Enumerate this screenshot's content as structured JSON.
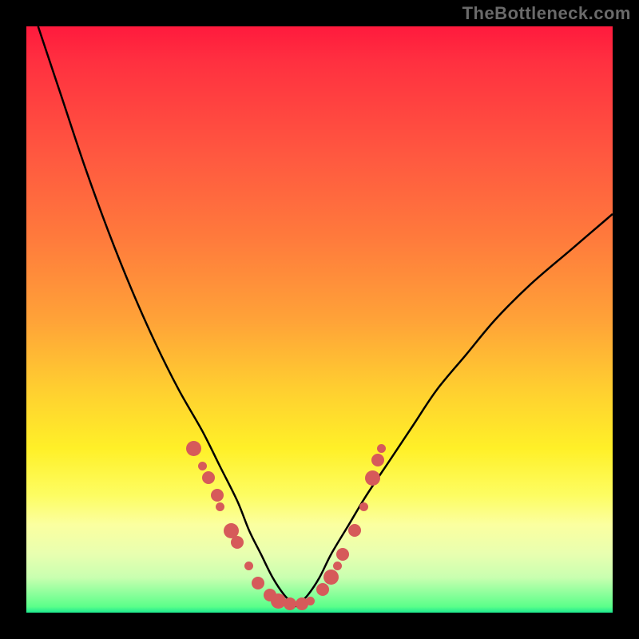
{
  "watermark": "TheBottleneck.com",
  "chart_data": {
    "type": "line",
    "title": "",
    "xlabel": "",
    "ylabel": "",
    "xlim": [
      0,
      100
    ],
    "ylim": [
      0,
      100
    ],
    "gradient_stops": [
      {
        "pct": 0,
        "color": "#ff1a3d"
      },
      {
        "pct": 6,
        "color": "#ff3040"
      },
      {
        "pct": 22,
        "color": "#ff5840"
      },
      {
        "pct": 36,
        "color": "#ff7a3c"
      },
      {
        "pct": 50,
        "color": "#ffa238"
      },
      {
        "pct": 62,
        "color": "#ffcf30"
      },
      {
        "pct": 72,
        "color": "#fff028"
      },
      {
        "pct": 80,
        "color": "#fdfd62"
      },
      {
        "pct": 85,
        "color": "#fbffa0"
      },
      {
        "pct": 90,
        "color": "#e8ffb0"
      },
      {
        "pct": 94,
        "color": "#c9ffb0"
      },
      {
        "pct": 99,
        "color": "#5aff8a"
      },
      {
        "pct": 100,
        "color": "#1de88f"
      }
    ],
    "series": [
      {
        "name": "left-curve",
        "x": [
          2,
          6,
          10,
          14,
          18,
          22,
          26,
          30,
          33,
          36,
          38,
          40,
          42,
          44,
          46
        ],
        "y": [
          100,
          88,
          76,
          65,
          55,
          46,
          38,
          31,
          25,
          19,
          14,
          10,
          6,
          3,
          1
        ]
      },
      {
        "name": "right-curve",
        "x": [
          46,
          48,
          50,
          52,
          55,
          58,
          62,
          66,
          70,
          75,
          80,
          86,
          93,
          100
        ],
        "y": [
          1,
          3,
          6,
          10,
          15,
          20,
          26,
          32,
          38,
          44,
          50,
          56,
          62,
          68
        ]
      }
    ],
    "points": [
      {
        "x": 28.5,
        "y": 28
      },
      {
        "x": 30.0,
        "y": 25
      },
      {
        "x": 31.0,
        "y": 23
      },
      {
        "x": 32.5,
        "y": 20
      },
      {
        "x": 33.0,
        "y": 18
      },
      {
        "x": 35.0,
        "y": 14
      },
      {
        "x": 36.0,
        "y": 12
      },
      {
        "x": 38.0,
        "y": 8
      },
      {
        "x": 39.5,
        "y": 5
      },
      {
        "x": 41.5,
        "y": 3
      },
      {
        "x": 43.0,
        "y": 2
      },
      {
        "x": 45.0,
        "y": 1.5
      },
      {
        "x": 47.0,
        "y": 1.5
      },
      {
        "x": 48.5,
        "y": 2
      },
      {
        "x": 50.5,
        "y": 4
      },
      {
        "x": 52.0,
        "y": 6
      },
      {
        "x": 53.0,
        "y": 8
      },
      {
        "x": 54.0,
        "y": 10
      },
      {
        "x": 56.0,
        "y": 14
      },
      {
        "x": 57.5,
        "y": 18
      },
      {
        "x": 59.0,
        "y": 23
      },
      {
        "x": 60.0,
        "y": 26
      },
      {
        "x": 60.5,
        "y": 28
      }
    ]
  }
}
